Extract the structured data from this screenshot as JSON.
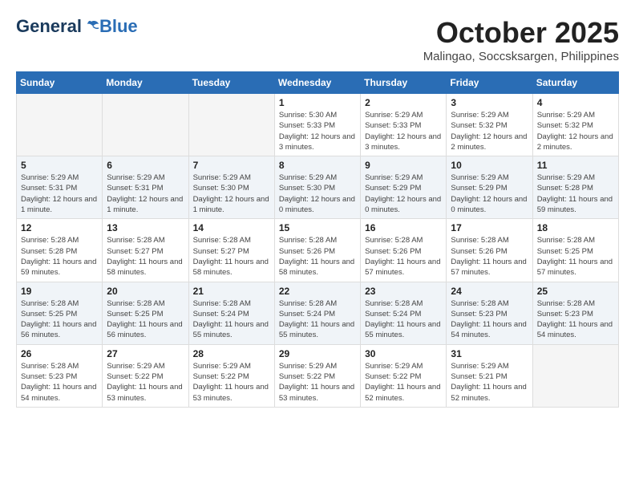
{
  "header": {
    "logo_general": "General",
    "logo_blue": "Blue",
    "month": "October 2025",
    "location": "Malingao, Soccsksargen, Philippines"
  },
  "weekdays": [
    "Sunday",
    "Monday",
    "Tuesday",
    "Wednesday",
    "Thursday",
    "Friday",
    "Saturday"
  ],
  "weeks": [
    [
      {
        "day": "",
        "info": ""
      },
      {
        "day": "",
        "info": ""
      },
      {
        "day": "",
        "info": ""
      },
      {
        "day": "1",
        "info": "Sunrise: 5:30 AM\nSunset: 5:33 PM\nDaylight: 12 hours and 3 minutes."
      },
      {
        "day": "2",
        "info": "Sunrise: 5:29 AM\nSunset: 5:33 PM\nDaylight: 12 hours and 3 minutes."
      },
      {
        "day": "3",
        "info": "Sunrise: 5:29 AM\nSunset: 5:32 PM\nDaylight: 12 hours and 2 minutes."
      },
      {
        "day": "4",
        "info": "Sunrise: 5:29 AM\nSunset: 5:32 PM\nDaylight: 12 hours and 2 minutes."
      }
    ],
    [
      {
        "day": "5",
        "info": "Sunrise: 5:29 AM\nSunset: 5:31 PM\nDaylight: 12 hours and 1 minute."
      },
      {
        "day": "6",
        "info": "Sunrise: 5:29 AM\nSunset: 5:31 PM\nDaylight: 12 hours and 1 minute."
      },
      {
        "day": "7",
        "info": "Sunrise: 5:29 AM\nSunset: 5:30 PM\nDaylight: 12 hours and 1 minute."
      },
      {
        "day": "8",
        "info": "Sunrise: 5:29 AM\nSunset: 5:30 PM\nDaylight: 12 hours and 0 minutes."
      },
      {
        "day": "9",
        "info": "Sunrise: 5:29 AM\nSunset: 5:29 PM\nDaylight: 12 hours and 0 minutes."
      },
      {
        "day": "10",
        "info": "Sunrise: 5:29 AM\nSunset: 5:29 PM\nDaylight: 12 hours and 0 minutes."
      },
      {
        "day": "11",
        "info": "Sunrise: 5:29 AM\nSunset: 5:28 PM\nDaylight: 11 hours and 59 minutes."
      }
    ],
    [
      {
        "day": "12",
        "info": "Sunrise: 5:28 AM\nSunset: 5:28 PM\nDaylight: 11 hours and 59 minutes."
      },
      {
        "day": "13",
        "info": "Sunrise: 5:28 AM\nSunset: 5:27 PM\nDaylight: 11 hours and 58 minutes."
      },
      {
        "day": "14",
        "info": "Sunrise: 5:28 AM\nSunset: 5:27 PM\nDaylight: 11 hours and 58 minutes."
      },
      {
        "day": "15",
        "info": "Sunrise: 5:28 AM\nSunset: 5:26 PM\nDaylight: 11 hours and 58 minutes."
      },
      {
        "day": "16",
        "info": "Sunrise: 5:28 AM\nSunset: 5:26 PM\nDaylight: 11 hours and 57 minutes."
      },
      {
        "day": "17",
        "info": "Sunrise: 5:28 AM\nSunset: 5:26 PM\nDaylight: 11 hours and 57 minutes."
      },
      {
        "day": "18",
        "info": "Sunrise: 5:28 AM\nSunset: 5:25 PM\nDaylight: 11 hours and 57 minutes."
      }
    ],
    [
      {
        "day": "19",
        "info": "Sunrise: 5:28 AM\nSunset: 5:25 PM\nDaylight: 11 hours and 56 minutes."
      },
      {
        "day": "20",
        "info": "Sunrise: 5:28 AM\nSunset: 5:25 PM\nDaylight: 11 hours and 56 minutes."
      },
      {
        "day": "21",
        "info": "Sunrise: 5:28 AM\nSunset: 5:24 PM\nDaylight: 11 hours and 55 minutes."
      },
      {
        "day": "22",
        "info": "Sunrise: 5:28 AM\nSunset: 5:24 PM\nDaylight: 11 hours and 55 minutes."
      },
      {
        "day": "23",
        "info": "Sunrise: 5:28 AM\nSunset: 5:24 PM\nDaylight: 11 hours and 55 minutes."
      },
      {
        "day": "24",
        "info": "Sunrise: 5:28 AM\nSunset: 5:23 PM\nDaylight: 11 hours and 54 minutes."
      },
      {
        "day": "25",
        "info": "Sunrise: 5:28 AM\nSunset: 5:23 PM\nDaylight: 11 hours and 54 minutes."
      }
    ],
    [
      {
        "day": "26",
        "info": "Sunrise: 5:28 AM\nSunset: 5:23 PM\nDaylight: 11 hours and 54 minutes."
      },
      {
        "day": "27",
        "info": "Sunrise: 5:29 AM\nSunset: 5:22 PM\nDaylight: 11 hours and 53 minutes."
      },
      {
        "day": "28",
        "info": "Sunrise: 5:29 AM\nSunset: 5:22 PM\nDaylight: 11 hours and 53 minutes."
      },
      {
        "day": "29",
        "info": "Sunrise: 5:29 AM\nSunset: 5:22 PM\nDaylight: 11 hours and 53 minutes."
      },
      {
        "day": "30",
        "info": "Sunrise: 5:29 AM\nSunset: 5:22 PM\nDaylight: 11 hours and 52 minutes."
      },
      {
        "day": "31",
        "info": "Sunrise: 5:29 AM\nSunset: 5:21 PM\nDaylight: 11 hours and 52 minutes."
      },
      {
        "day": "",
        "info": ""
      }
    ]
  ]
}
